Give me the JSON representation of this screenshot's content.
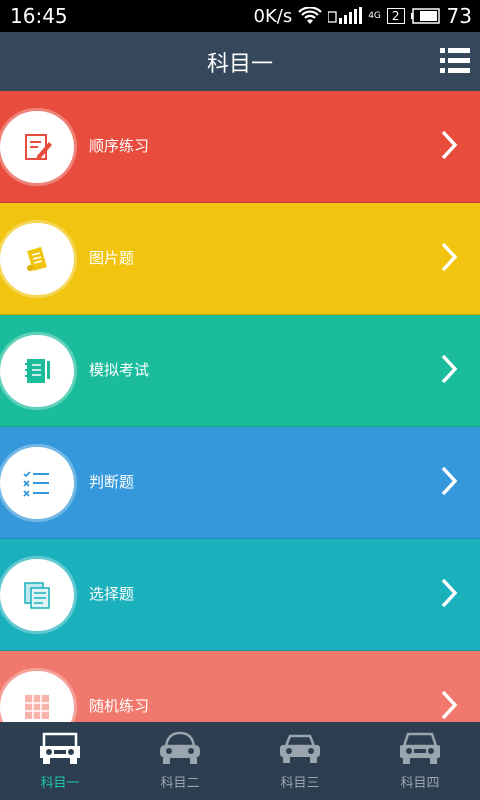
{
  "status_bar": {
    "time": "16:45",
    "net_speed": "0K/s",
    "sim_badge": "2",
    "network_type": "4G",
    "battery": "73",
    "icons": [
      "wifi-icon",
      "signal-icon",
      "battery-icon"
    ]
  },
  "header": {
    "title": "科目一",
    "menu_icon": "list-menu-icon"
  },
  "list": {
    "items": [
      {
        "label": "顺序练习",
        "icon": "pencil-note-icon",
        "color": "#e84c3d"
      },
      {
        "label": "图片题",
        "icon": "scroll-icon",
        "color": "#f1c40f"
      },
      {
        "label": "模拟考试",
        "icon": "notebook-icon",
        "color": "#1abc9c"
      },
      {
        "label": "判断题",
        "icon": "checklist-icon",
        "color": "#3498db"
      },
      {
        "label": "选择题",
        "icon": "documents-icon",
        "color": "#1ab0bc"
      },
      {
        "label": "随机练习",
        "icon": "grid-icon",
        "color": "#f1786d"
      }
    ]
  },
  "tabbar": {
    "active_color": "#1ec6a7",
    "tabs": [
      {
        "label": "科目一",
        "icon": "jeep-icon",
        "active": true
      },
      {
        "label": "科目二",
        "icon": "beetle-car-icon",
        "active": false
      },
      {
        "label": "科目三",
        "icon": "sedan-icon",
        "active": false
      },
      {
        "label": "科目四",
        "icon": "suv-icon",
        "active": false
      }
    ]
  }
}
